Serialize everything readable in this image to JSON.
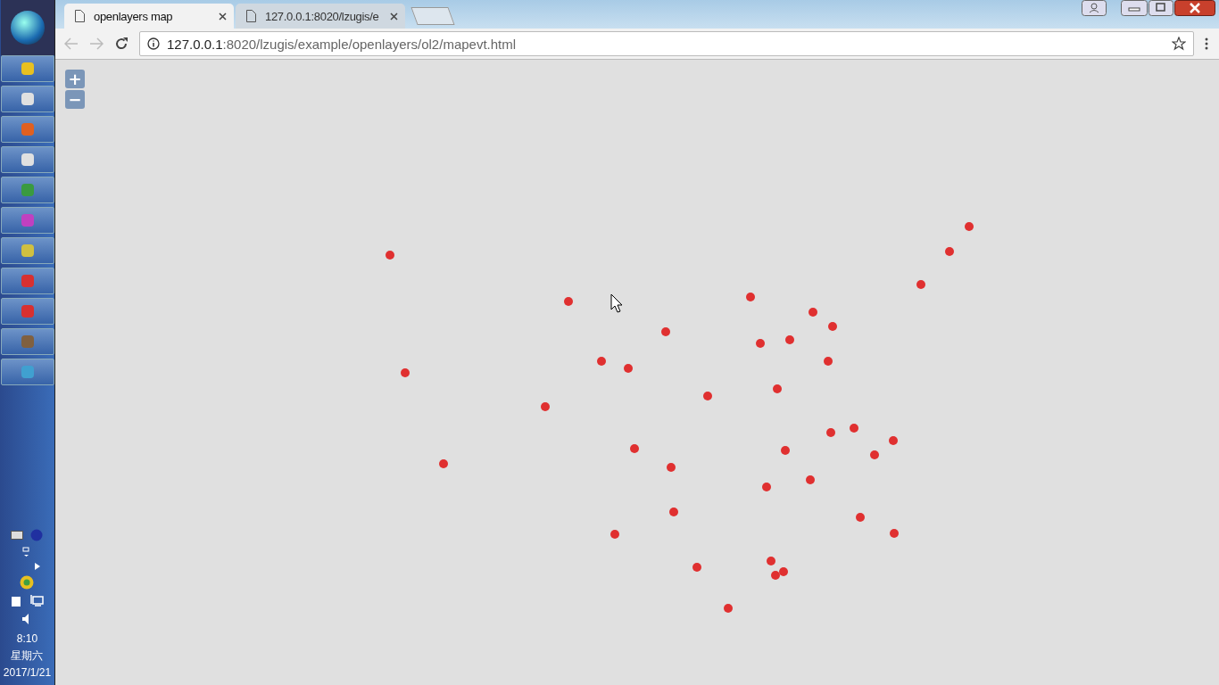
{
  "browser": {
    "tabs": [
      {
        "title": "openlayers map",
        "selected": true
      },
      {
        "title": "127.0.0.1:8020/lzugis/e",
        "selected": false
      }
    ],
    "address": {
      "host": "127.0.0.1",
      "path": ":8020/lzugis/example/openlayers/ol2/mapevt.html"
    }
  },
  "map": {
    "zoom_in": "+",
    "zoom_out": "−"
  },
  "taskbar": {
    "time": "8:10",
    "weekday": "星期六",
    "date": "2017/1/21"
  }
}
